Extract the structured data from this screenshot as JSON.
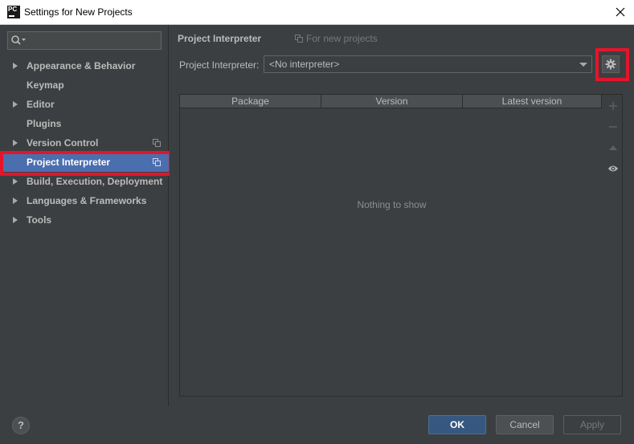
{
  "window": {
    "title": "Settings for New Projects",
    "app_icon_text": "PC"
  },
  "sidebar": {
    "search_placeholder": "",
    "items": [
      {
        "label": "Appearance & Behavior",
        "expandable": true,
        "copy_icon": false
      },
      {
        "label": "Keymap",
        "expandable": false,
        "copy_icon": false
      },
      {
        "label": "Editor",
        "expandable": true,
        "copy_icon": false
      },
      {
        "label": "Plugins",
        "expandable": false,
        "copy_icon": false
      },
      {
        "label": "Version Control",
        "expandable": true,
        "copy_icon": true
      },
      {
        "label": "Project Interpreter",
        "expandable": false,
        "copy_icon": true,
        "selected": true
      },
      {
        "label": "Build, Execution, Deployment",
        "expandable": true,
        "copy_icon": false
      },
      {
        "label": "Languages & Frameworks",
        "expandable": true,
        "copy_icon": false
      },
      {
        "label": "Tools",
        "expandable": true,
        "copy_icon": false
      }
    ]
  },
  "main": {
    "title": "Project Interpreter",
    "scope_label": "For new projects",
    "interpreter_label": "Project Interpreter:",
    "interpreter_value": "<No interpreter>",
    "table": {
      "columns": [
        "Package",
        "Version",
        "Latest version"
      ],
      "empty_text": "Nothing to show"
    },
    "tools": [
      "plus-icon",
      "minus-icon",
      "up-arrow-icon",
      "eye-icon"
    ]
  },
  "footer": {
    "help_label": "?",
    "ok_label": "OK",
    "cancel_label": "Cancel",
    "apply_label": "Apply"
  },
  "colors": {
    "background": "#3c3f41",
    "selection": "#4b6eaf",
    "highlight": "#e3152b",
    "ok_button": "#365880"
  }
}
